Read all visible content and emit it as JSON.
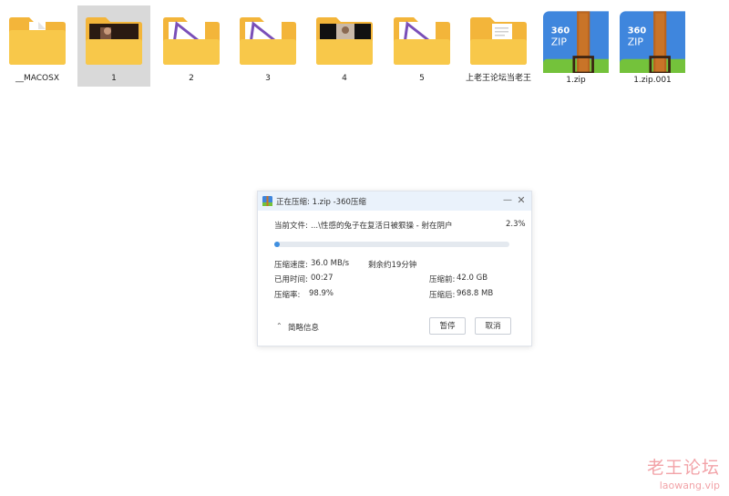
{
  "files": [
    {
      "name": "__MACOSX",
      "type": "folder",
      "thumb": "doc"
    },
    {
      "name": "1",
      "type": "folder",
      "thumb": "photo-dark",
      "selected": true
    },
    {
      "name": "2",
      "type": "folder",
      "thumb": "logo"
    },
    {
      "name": "3",
      "type": "folder",
      "thumb": "logo"
    },
    {
      "name": "4",
      "type": "folder",
      "thumb": "photo-portrait"
    },
    {
      "name": "5",
      "type": "folder",
      "thumb": "logo"
    },
    {
      "name": "上老王论坛当老王",
      "type": "folder",
      "thumb": "doc"
    },
    {
      "name": "1.zip",
      "type": "zip",
      "zip_text": "360 ZIP"
    },
    {
      "name": "1.zip.001",
      "type": "zip",
      "zip_text": "360 ZIP"
    }
  ],
  "dialog": {
    "title": "正在压缩: 1.zip -360压缩",
    "current_file_label": "当前文件:",
    "current_file": "...\\性感的兔子在复活日被狠操 - 射在阴户",
    "percent": "2.3%",
    "progress": 0.023,
    "speed_label": "压缩速度:",
    "speed": "36.0 MB/s",
    "remaining": "剩余约19分钟",
    "elapsed_label": "已用时间:",
    "elapsed": "00:27",
    "ratio_label": "压缩率:",
    "ratio": "98.9%",
    "before_label": "压缩前:",
    "before": "42.0 GB",
    "after_label": "压缩后:",
    "after": "968.8 MB",
    "toggle_label": "简略信息",
    "pause_label": "暂停",
    "cancel_label": "取消"
  },
  "watermark": {
    "title": "老王论坛",
    "url": "laowang.vip"
  },
  "colors": {
    "folder": "#f8c84a",
    "folder_back": "#f3b53a",
    "zip_blue": "#3f86dd",
    "zip_green": "#74c23b",
    "zip_strap": "#b9641f",
    "accent": "#3f8fe0",
    "titlebar": "#eaf2fb"
  }
}
